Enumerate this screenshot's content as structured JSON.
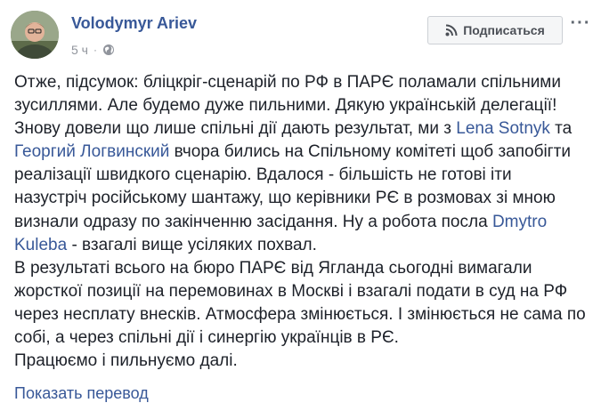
{
  "author": {
    "name": "Volodymyr Ariev"
  },
  "meta": {
    "time": "5 ч",
    "separator": "·"
  },
  "header": {
    "subscribe_label": "Подписаться",
    "more_label": "···"
  },
  "post": {
    "line1": "Отже, підсумок: бліцкріг-сценарій по РФ в ПАРЄ поламали спільними",
    "line2": "зусиллями. Але будемо дуже пильними. Дякую українській делегації!",
    "line3_a": "Знову довели що лише спільні дії дають результат, ми з ",
    "link_lena": "Lena Sotnyk",
    "line3_b": " та",
    "link_georgiy": "Георгий Логвинский",
    "line4_b": " вчора бились на Спільному комітеті щоб запобігти",
    "line5": "реалізації швидкого сценарію. Вдалося - більшість не готові іти",
    "line6": "назустріч російському шантажу, що керівники РЄ в розмовах зі мною",
    "line7_a": "визнали одразу по закінченню засідання. Ну а робота посла ",
    "link_dmytro": "Dmytro",
    "link_kuleba": "Kuleba",
    "line8_b": " - взагалі вище усіляких похвал.",
    "line9": "В результаті всього на бюро ПАРЄ від Ягланда сьогодні вимагали",
    "line10": "жорсткої позиції на перемовинах в Москві і взагалі подати в суд на РФ",
    "line11": "через несплату внесків. Атмосфера змінюється. І змінюється не сама по",
    "line12": "собі, а через спільні дії і синергію українців в РЄ.",
    "line13": "Працюємо і пильнуємо далі."
  },
  "translate_link": "Показать перевод",
  "colors": {
    "link": "#385898",
    "text": "#1d2129",
    "meta": "#90949c"
  }
}
